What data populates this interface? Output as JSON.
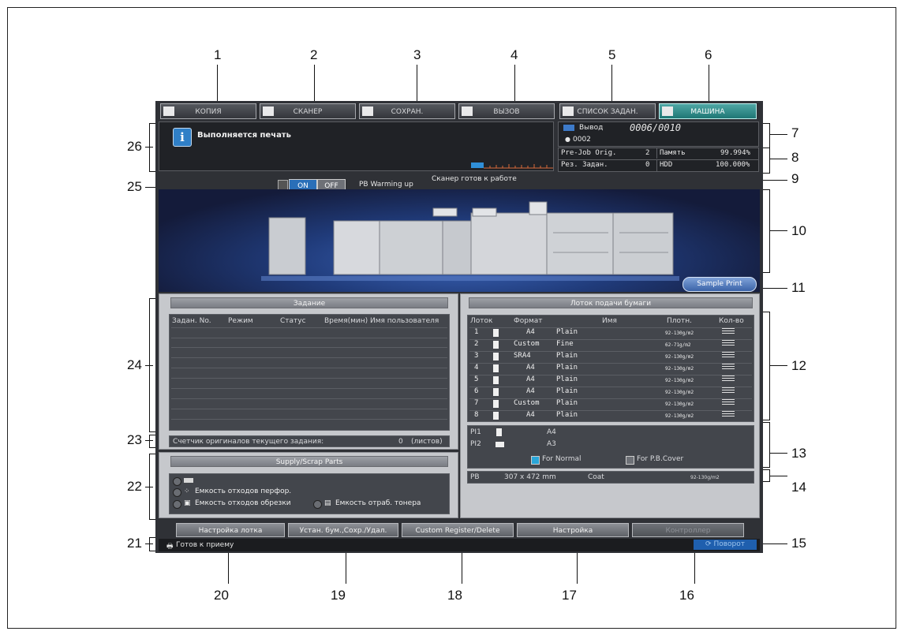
{
  "callouts": [
    "1",
    "2",
    "3",
    "4",
    "5",
    "6",
    "7",
    "8",
    "9",
    "10",
    "11",
    "12",
    "13",
    "14",
    "15",
    "16",
    "17",
    "18",
    "19",
    "20",
    "21",
    "22",
    "23",
    "24",
    "25",
    "26"
  ],
  "tabs": [
    {
      "label": "КОПИЯ",
      "icon": "document-icon"
    },
    {
      "label": "СКАНЕР",
      "icon": "scanner-icon"
    },
    {
      "label": "СОХРАН.",
      "icon": "save-box-icon"
    },
    {
      "label": "ВЫЗОВ",
      "icon": "recall-box-icon"
    },
    {
      "label": "СПИСОК ЗАДАН.",
      "icon": "job-list-icon"
    },
    {
      "label": "МАШИНА",
      "icon": "machine-icon"
    }
  ],
  "message": {
    "text": "Выполняется печать",
    "icon": "info-icon"
  },
  "output": {
    "label": "Вывод",
    "counter": "0006/0010",
    "user_count": "0002"
  },
  "stats": {
    "prejob_label": "Pre-Job Orig.",
    "prejob_value": "2",
    "memory_label": "Память",
    "memory_value": "99.994%",
    "reserve_label": "Рез. Задан.",
    "reserve_value": "0",
    "hdd_label": "HDD",
    "hdd_value": "100.000%"
  },
  "toggle": {
    "on": "ON",
    "off": "OFF",
    "label": "PB Warming up"
  },
  "scanner_status": "Сканер готов к работе",
  "sample_print": "Sample Print",
  "job_panel": {
    "title": "Задание",
    "columns": [
      "Задан. No.",
      "Режим",
      "Статус",
      "Время(мин)",
      "Имя пользователя"
    ],
    "counter_label": "Счетчик оригиналов текущего задания:",
    "counter_value": "0",
    "counter_unit": "(листов)"
  },
  "supply_panel": {
    "title": "Supply/Scrap Parts",
    "punch": "Емкость отходов перфор.",
    "trim": "Емкость отходов обрезки",
    "toner": "Емкость отраб. тонера"
  },
  "tray_panel": {
    "title": "Лоток подачи бумаги",
    "columns": [
      "Лоток",
      "Формат",
      "Имя",
      "Плотн.",
      "Кол-во"
    ],
    "rows": [
      {
        "tray": "1",
        "size": "A4",
        "name": "Plain",
        "weight": "92-130g/m2"
      },
      {
        "tray": "2",
        "size": "Custom",
        "name": "Fine",
        "weight": "62-71g/m2"
      },
      {
        "tray": "3",
        "size": "SRA4",
        "name": "Plain",
        "weight": "92-130g/m2"
      },
      {
        "tray": "4",
        "size": "A4",
        "name": "Plain",
        "weight": "92-130g/m2"
      },
      {
        "tray": "5",
        "size": "A4",
        "name": "Plain",
        "weight": "92-130g/m2"
      },
      {
        "tray": "6",
        "size": "A4",
        "name": "Plain",
        "weight": "92-130g/m2"
      },
      {
        "tray": "7",
        "size": "Custom",
        "name": "Plain",
        "weight": "92-130g/m2"
      },
      {
        "tray": "8",
        "size": "A4",
        "name": "Plain",
        "weight": "92-130g/m2"
      }
    ],
    "pi1_label": "PI1",
    "pi1_size": "A4",
    "pi2_label": "PI2",
    "pi2_size": "A3",
    "for_normal": "For Normal",
    "for_pb_cover": "For P.B.Cover",
    "pb_label": "PB",
    "pb_size": "307 x 472 mm",
    "pb_name": "Coat",
    "pb_weight": "92-130g/m2"
  },
  "buttons": {
    "tray_setting": "Настройка лотка",
    "paper_save": "Устан. бум.,Сохр./Удал.",
    "custom_register": "Custom Register/Delete",
    "setting": "Настройка",
    "controller": "Контроллер"
  },
  "status": {
    "ready": "Готов к приему",
    "rotate": "Поворот"
  },
  "colors": {
    "active_tab": "#1e7775",
    "accent": "#2f7fc7",
    "background": "#2f3136"
  }
}
